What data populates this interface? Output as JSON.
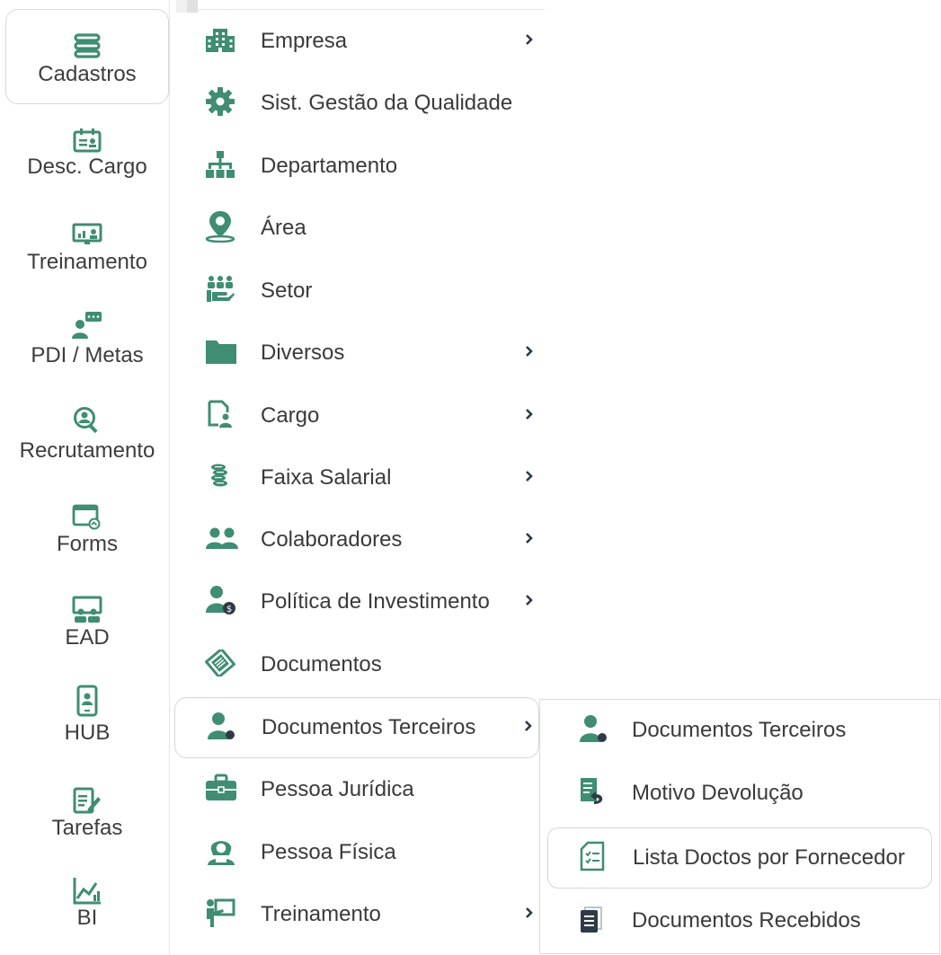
{
  "colors": {
    "accent": "#3f8d72",
    "text": "#3a3a3a",
    "border": "#d6d6d6"
  },
  "rail": {
    "items": [
      {
        "label": "Cadastros",
        "icon": "cadastros-icon"
      },
      {
        "label": "Desc. Cargo",
        "icon": "id-card-icon"
      },
      {
        "label": "Treinamento",
        "icon": "presentation-icon"
      },
      {
        "label": "PDI / Metas",
        "icon": "person-chat-icon"
      },
      {
        "label": "Recrutamento",
        "icon": "search-person-icon"
      },
      {
        "label": "Forms",
        "icon": "form-window-icon"
      },
      {
        "label": "EAD",
        "icon": "classroom-icon"
      },
      {
        "label": "HUB",
        "icon": "phone-person-icon"
      },
      {
        "label": "Tarefas",
        "icon": "edit-document-icon"
      },
      {
        "label": "BI",
        "icon": "chart-icon"
      }
    ]
  },
  "menu": {
    "items": [
      {
        "label": "Empresa",
        "icon": "building-icon",
        "submenu": true
      },
      {
        "label": "Sist. Gestão da Qualidade",
        "icon": "gear-icon",
        "submenu": false
      },
      {
        "label": "Departamento",
        "icon": "org-chart-icon",
        "submenu": false
      },
      {
        "label": "Área",
        "icon": "map-pin-icon",
        "submenu": false
      },
      {
        "label": "Setor",
        "icon": "team-hand-icon",
        "submenu": false
      },
      {
        "label": "Diversos",
        "icon": "folder-icon",
        "submenu": true
      },
      {
        "label": "Cargo",
        "icon": "document-person-icon",
        "submenu": true
      },
      {
        "label": "Faixa Salarial",
        "icon": "coins-icon",
        "submenu": true
      },
      {
        "label": "Colaboradores",
        "icon": "people-icon",
        "submenu": true
      },
      {
        "label": "Política de Investimento",
        "icon": "person-money-icon",
        "submenu": true
      },
      {
        "label": "Documentos",
        "icon": "documents-icon",
        "submenu": false
      },
      {
        "label": "Documentos Terceiros",
        "icon": "person-icon",
        "submenu": true
      },
      {
        "label": "Pessoa Jurídica",
        "icon": "briefcase-icon",
        "submenu": false
      },
      {
        "label": "Pessoa Física",
        "icon": "woman-icon",
        "submenu": false
      },
      {
        "label": "Treinamento",
        "icon": "teacher-board-icon",
        "submenu": true
      }
    ]
  },
  "submenu": {
    "items": [
      {
        "label": "Documentos Terceiros",
        "icon": "person-icon"
      },
      {
        "label": "Motivo Devolução",
        "icon": "return-document-icon"
      },
      {
        "label": "Lista Doctos por Fornecedor",
        "icon": "checklist-icon"
      },
      {
        "label": "Documentos Recebidos",
        "icon": "received-documents-icon"
      }
    ]
  }
}
